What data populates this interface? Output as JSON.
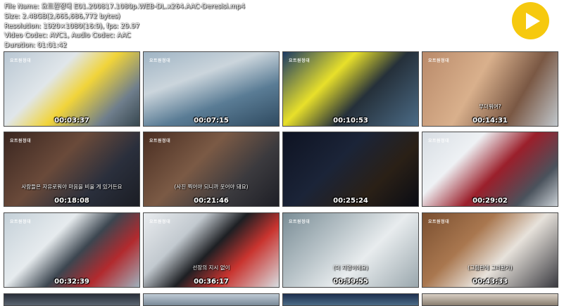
{
  "file_info": {
    "file_name": "File Name: 요트원정대 E01.200817.1080p.WEB-DL.x264.AAC-Deresisi.mp4",
    "size": "Size: 2.48GB(2,665,686,772 bytes)",
    "resolution": "Resolution: 1920×1080(16:9), fps: 29.97",
    "codec": "Video Codec: AVC1, Audio Codec: AAC",
    "duration": "Duration: 01:01:42"
  },
  "play_button": {
    "icon": "play-icon",
    "color": "#f6c90e"
  },
  "thumbnails": [
    {
      "time": "00:03:37",
      "caption": "",
      "logo": "요트원정대",
      "bg": "linear-gradient(135deg,#b9c7d3 0%,#e0e6ea 35%,#f1d43a 55%,#6f7e8c 80%,#37474f 100%)"
    },
    {
      "time": "00:07:15",
      "caption": "",
      "logo": "요트원정대",
      "bg": "linear-gradient(160deg,#9fb4c4 0%,#cbd5dc 35%,#5a7c95 65%,#2f4a60 100%)"
    },
    {
      "time": "00:10:53",
      "caption": "",
      "logo": "요트원정대",
      "bg": "linear-gradient(135deg,#1c3b66 0%,#e8e02a 35%,#25303a 60%,#4b6b86 100%)"
    },
    {
      "time": "00:14:31",
      "caption": "무더워여?",
      "logo": "요트원정대",
      "bg": "linear-gradient(120deg,#b98a6a 0%,#d9b08c 40%,#7a5844 70%,#c0c7cc 100%)"
    },
    {
      "time": "00:18:08",
      "caption": "사람들은 자유로워야 마음을 비울 게 있거든요",
      "logo": "요트원정대",
      "bg": "linear-gradient(135deg,#3a2620 0%,#6a4a3a 40%,#2a2f3c 70%,#1b1d24 100%)"
    },
    {
      "time": "00:21:46",
      "caption": "(사진 찍어야 되니까 웃어야 돼요)",
      "logo": "요트원정대",
      "bg": "linear-gradient(135deg,#4a2e22 0%,#7b5a45 40%,#3b3a3e 70%,#1e1f26 100%)"
    },
    {
      "time": "00:25:24",
      "caption": "",
      "logo": "",
      "bg": "linear-gradient(135deg,#0e1322 0%,#1b2438 40%,#2a2016 70%,#0a0c14 100%)"
    },
    {
      "time": "00:29:02",
      "caption": "",
      "logo": "요트원정대",
      "bg": "linear-gradient(135deg,#d7dde3 0%,#eef1f4 30%,#9b1f2b 55%,#4a525c 80%,#c9cfd4 100%)"
    },
    {
      "time": "00:32:39",
      "caption": "",
      "logo": "요트원정대",
      "bg": "linear-gradient(135deg,#c4d0d8 0%,#e6ebee 35%,#3c4650 55%,#b22a2e 75%,#9fb0bc 100%)"
    },
    {
      "time": "00:36:17",
      "caption": "선장의 지시 없이",
      "logo": "요트원정대",
      "bg": "linear-gradient(135deg,#e9ecef 0%,#c2c9cf 30%,#1d1f23 50%,#c9342f 70%,#d7dce0 100%)"
    },
    {
      "time": "00:39:55",
      "caption": "(더 지명이에요)",
      "logo": "요트원정대",
      "bg": "linear-gradient(135deg,#7a8d96 0%,#b8c3c8 35%,#e8ecee 60%,#9aa7ad 100%)"
    },
    {
      "time": "00:43:33",
      "caption": "(그림판에 그려봤가)",
      "logo": "요트원정대",
      "bg": "linear-gradient(135deg,#7a4f30 0%,#a9774f 35%,#e7e2db 60%,#3a3a40 100%)"
    },
    {
      "time": "",
      "caption": "",
      "logo": "",
      "bg": "linear-gradient(180deg,#2a2f3a 0%,#5a6470 100%)"
    },
    {
      "time": "",
      "caption": "",
      "logo": "",
      "bg": "linear-gradient(180deg,#bfcbd6 0%,#7a8a98 100%)"
    },
    {
      "time": "",
      "caption": "",
      "logo": "",
      "bg": "linear-gradient(180deg,#1e3050 0%,#4b6b86 100%)"
    },
    {
      "time": "",
      "caption": "",
      "logo": "",
      "bg": "linear-gradient(180deg,#d8cfc4 0%,#8a7e70 100%)"
    }
  ]
}
